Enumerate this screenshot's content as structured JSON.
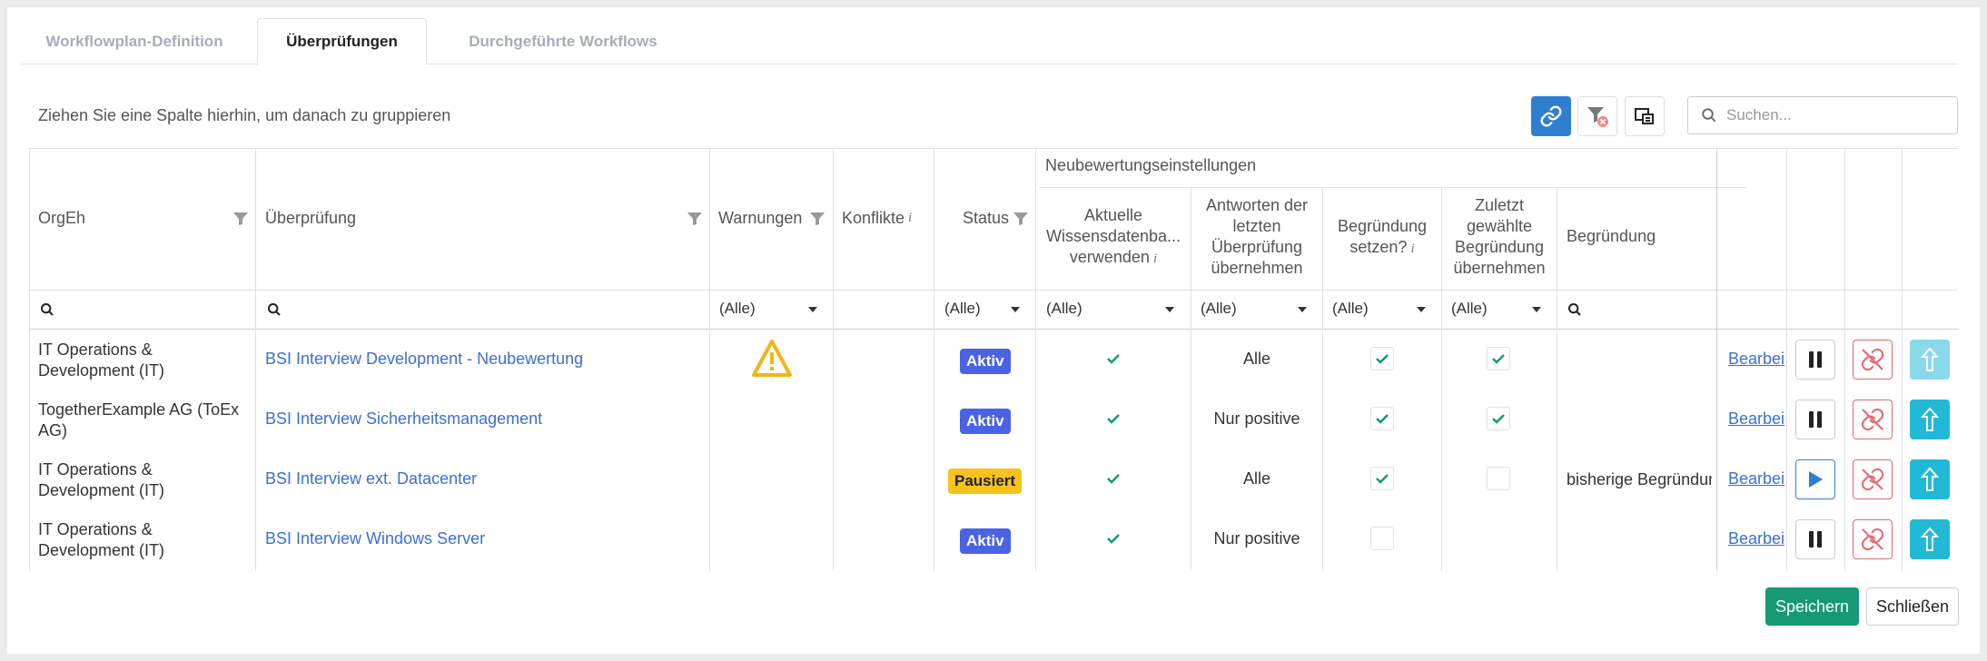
{
  "tabs": [
    "Workflowplan-Definition",
    "Überprüfungen",
    "Durchgeführte Workflows"
  ],
  "toolbar": {
    "group_hint": "Ziehen Sie eine Spalte hierhin, um danach zu gruppieren",
    "search_placeholder": "Suchen...",
    "link_icon": "link-icon",
    "clear_filter_icon": "filter-clear-icon",
    "column_chooser_icon": "column-chooser-icon"
  },
  "columns": {
    "orgeh": "OrgEh",
    "pruefung": "Überprüfung",
    "warnungen": "Warnungen",
    "konflikte": "Konflikte",
    "status": "Status",
    "group": "Neubewertungseinstellungen",
    "aktuelle_1": "Aktuelle",
    "aktuelle_2": "Wissensdatenba...",
    "aktuelle_3": "verwenden",
    "antworten_1": "Antworten der",
    "antworten_2": "letzten",
    "antworten_3": "Überprüfung",
    "antworten_4": "übernehmen",
    "begr_setzen_1": "Begründung",
    "begr_setzen_2": "setzen?",
    "zuletzt_1": "Zuletzt",
    "zuletzt_2": "gewählte",
    "zuletzt_3": "Begründung",
    "zuletzt_4": "übernehmen",
    "begruendung": "Begründung",
    "info_marker": "i"
  },
  "filters": {
    "warnungen": "(Alle)",
    "status": "(Alle)",
    "aktuelle": "(Alle)",
    "antworten": "(Alle)",
    "begr_setzen": "(Alle)",
    "zuletzt": "(Alle)"
  },
  "rows": [
    {
      "orgeh_1": "IT Operations &",
      "orgeh_2": "Development (IT)",
      "pruefung": "BSI Interview Development - Neubewertung",
      "warning": true,
      "status": "Aktiv",
      "aktuelle": true,
      "antworten": "Alle",
      "begr_setzen": true,
      "zuletzt": true,
      "begruendung": "",
      "edit": "Bearbei",
      "action": "pause",
      "up_disabled": true
    },
    {
      "orgeh_1": "TogetherExample AG (ToEx",
      "orgeh_2": "AG)",
      "pruefung": "BSI Interview Sicherheitsmanagement",
      "warning": false,
      "status": "Aktiv",
      "aktuelle": true,
      "antworten": "Nur positive",
      "begr_setzen": true,
      "zuletzt": true,
      "begruendung": "",
      "edit": "Bearbei",
      "action": "pause",
      "up_disabled": false
    },
    {
      "orgeh_1": "IT Operations &",
      "orgeh_2": "Development (IT)",
      "pruefung": "BSI Interview ext. Datacenter",
      "warning": false,
      "status": "Pausiert",
      "aktuelle": true,
      "antworten": "Alle",
      "begr_setzen": true,
      "zuletzt": false,
      "begruendung": "bisherige Begründung",
      "edit": "Bearbei",
      "action": "play",
      "up_disabled": false
    },
    {
      "orgeh_1": "IT Operations &",
      "orgeh_2": "Development (IT)",
      "pruefung": "BSI Interview Windows Server",
      "warning": false,
      "status": "Aktiv",
      "aktuelle": true,
      "antworten": "Nur positive",
      "begr_setzen": false,
      "zuletzt": null,
      "begruendung": "",
      "edit": "Bearbei",
      "action": "pause",
      "up_disabled": false
    }
  ],
  "footer": {
    "save": "Speichern",
    "close": "Schließen"
  },
  "colors": {
    "primary": "#2f7fd1",
    "link": "#3b6fd6",
    "aktiv": "#4a63e5",
    "pausiert": "#f7c21b",
    "success": "#159a73",
    "danger": "#e56a72",
    "info": "#22b9d6"
  }
}
